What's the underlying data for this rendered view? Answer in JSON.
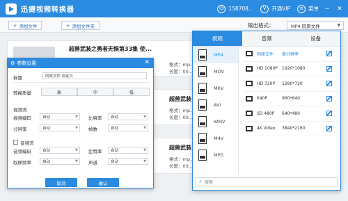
{
  "titlebar": {
    "app_title": "迅捷视频转换器",
    "user": "158708...",
    "vip": "开通VIP",
    "menu": "菜单"
  },
  "toolbar": {
    "add_file": "添加文件",
    "add_folder": "添加文件夹",
    "output_format_label": "输出格式：",
    "output_format_value": "MP4 同原文件"
  },
  "file_rows": [
    {
      "title": "超兽武装之勇者无惧第33集 使...",
      "title_short": "超兽武装",
      "format_label": "格式：mp...",
      "length_label": "长度：00..."
    },
    {
      "title": "超兽武装",
      "title_short": "超兽武装",
      "format_label": "格式：mp...",
      "length_label": "长度：00..."
    },
    {
      "title": "超兽武装",
      "title_short": "超兽武装",
      "format_label": "格式：mp...",
      "length_label": "长度：00..."
    }
  ],
  "dialog": {
    "title": "参数设置",
    "title_label": "标题",
    "title_value": "同原文件  自定义",
    "quality_label": "转换质量",
    "quality_options": [
      "高",
      "中",
      "低"
    ],
    "video_section": "视频流",
    "video_codec_label": "视频编码",
    "video_codec_value": "自动",
    "bitrate_label": "比特率",
    "bitrate_value": "自动",
    "resolution_label": "分辨率",
    "resolution_value": "自动",
    "fps_label": "帧数",
    "fps_value": "自动",
    "audio_section": "音频流",
    "audio_codec_label": "音频编码",
    "audio_codec_value": "自动",
    "audio_bitrate_label": "比特率",
    "audio_bitrate_value": "自动",
    "sample_rate_label": "取样频率",
    "sample_rate_value": "自动",
    "channel_label": "声道",
    "channel_value": "自动",
    "cancel": "取消",
    "ok": "确认"
  },
  "format_panel": {
    "tabs": [
      "视频",
      "音频",
      "设备"
    ],
    "formats": [
      "MP4",
      "MOV",
      "MKV",
      "AVI",
      "WMV",
      "M4V",
      "MPG"
    ],
    "qualities": [
      {
        "name": "同原文件",
        "res": "原分辨率"
      },
      {
        "name": "HD 1080P",
        "res": "1920*1080"
      },
      {
        "name": "HD 720P",
        "res": "1280*720"
      },
      {
        "name": "640P",
        "res": "960*640"
      },
      {
        "name": "SD 480P",
        "res": "640*480"
      },
      {
        "name": "4K Video",
        "res": "3840*2160"
      }
    ],
    "search_placeholder": "搜索"
  }
}
